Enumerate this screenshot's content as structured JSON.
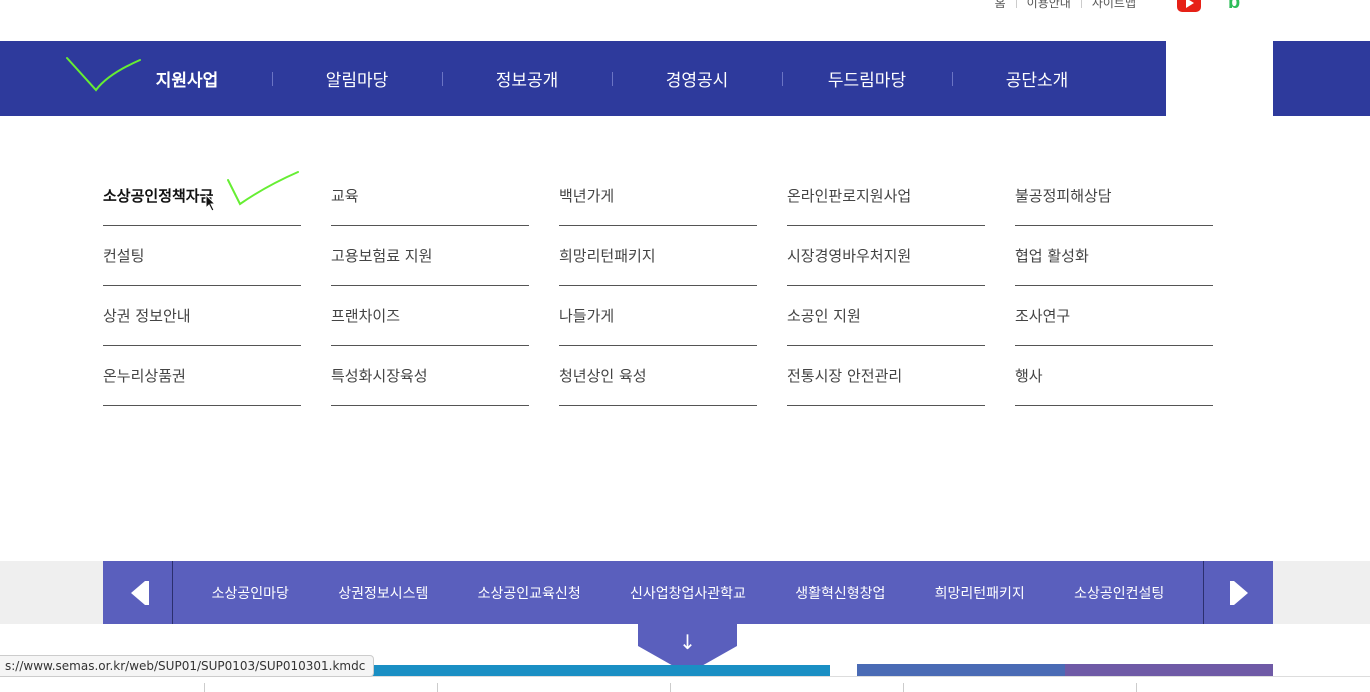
{
  "util_links": [
    "홈",
    "이용안내",
    "사이트맵"
  ],
  "social": {
    "youtube": "youtube-icon",
    "blog": "b"
  },
  "gnb": {
    "items": [
      "지원사업",
      "알림마당",
      "정보공개",
      "경영공시",
      "두드림마당",
      "공단소개"
    ],
    "active_index": 0
  },
  "mega_menu": {
    "columns": [
      [
        "소상공인정책자금",
        "컨설팅",
        "상권 정보안내",
        "온누리상품권"
      ],
      [
        "교육",
        "고용보험료 지원",
        "프랜차이즈",
        "특성화시장육성"
      ],
      [
        "백년가게",
        "희망리턴패키지",
        "나들가게",
        "청년상인 육성"
      ],
      [
        "온라인판로지원사업",
        "시장경영바우처지원",
        "소공인 지원",
        "전통시장 안전관리"
      ],
      [
        "불공정피해상담",
        "협업 활성화",
        "조사연구",
        "행사"
      ]
    ],
    "hovered": "소상공인정책자금"
  },
  "quick_links": [
    "소상공인마당",
    "상권정보시스템",
    "소상공인교육신청",
    "신사업창업사관학교",
    "생활혁신형창업",
    "희망리턴패키지",
    "소상공인컨설팅"
  ],
  "down_arrow": "↓",
  "status_url": "s://www.semas.or.kr/web/SUP01/SUP0103/SUP010301.kmdc",
  "colors": {
    "nav": "#2e3a9c",
    "quick": "#5a5fbd",
    "check": "#66ee33"
  }
}
